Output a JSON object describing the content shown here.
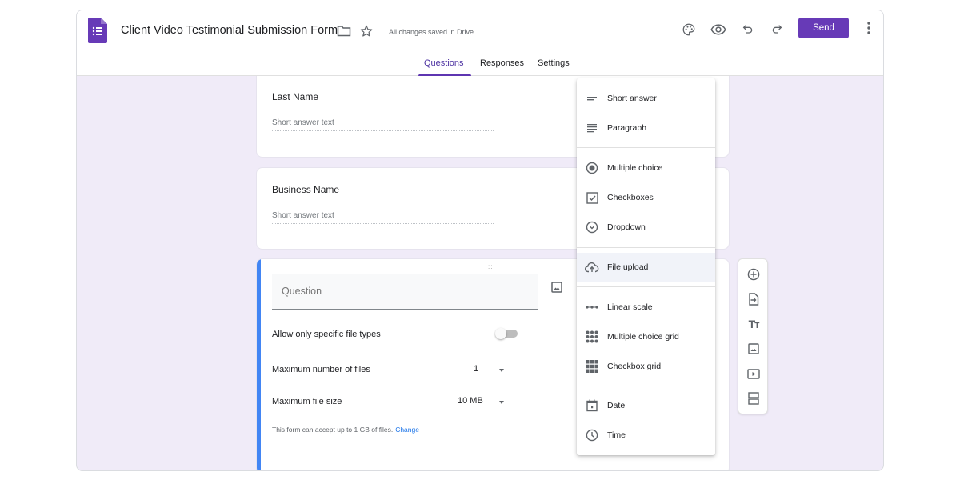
{
  "header": {
    "title": "Client Video Testimonial Submission Form",
    "save_status": "All changes saved in Drive",
    "send_label": "Send",
    "icons": [
      "palette-icon",
      "eye-icon",
      "undo-icon",
      "redo-icon",
      "more-vert-icon"
    ],
    "brand_color": "#673ab7"
  },
  "tabs": [
    {
      "label": "Questions",
      "active": true
    },
    {
      "label": "Responses",
      "active": false
    },
    {
      "label": "Settings",
      "active": false
    }
  ],
  "cards": {
    "last_name": {
      "title": "Last Name",
      "placeholder": "Short answer text"
    },
    "business_name": {
      "title": "Business Name",
      "placeholder": "Short answer text"
    }
  },
  "active_question": {
    "placeholder": "Question",
    "drag_handle": ":::",
    "allow_specific_types_label": "Allow only specific file types",
    "allow_specific_types_on": false,
    "max_files_label": "Maximum number of files",
    "max_files_value": "1",
    "max_size_label": "Maximum file size",
    "max_size_value": "10 MB",
    "limit_note": "This form can accept up to 1 GB of files.",
    "change_link": "Change",
    "accent_color": "#4285f4"
  },
  "type_menu": {
    "items": [
      {
        "label": "Short answer",
        "icon": "short-answer-icon"
      },
      {
        "label": "Paragraph",
        "icon": "paragraph-icon"
      },
      {
        "label": "Multiple choice",
        "icon": "radio-icon"
      },
      {
        "label": "Checkboxes",
        "icon": "checkbox-icon"
      },
      {
        "label": "Dropdown",
        "icon": "dropdown-icon"
      },
      {
        "label": "File upload",
        "icon": "cloud-upload-icon",
        "highlighted": true
      },
      {
        "label": "Linear scale",
        "icon": "linear-scale-icon"
      },
      {
        "label": "Multiple choice grid",
        "icon": "mc-grid-icon"
      },
      {
        "label": "Checkbox grid",
        "icon": "checkbox-grid-icon"
      },
      {
        "label": "Date",
        "icon": "calendar-icon"
      },
      {
        "label": "Time",
        "icon": "clock-icon"
      }
    ]
  },
  "float_toolbar": {
    "buttons": [
      "add-question-icon",
      "import-questions-icon",
      "add-title-icon",
      "add-image-icon",
      "add-video-icon",
      "add-section-icon"
    ],
    "title_glyph": "Tт"
  }
}
